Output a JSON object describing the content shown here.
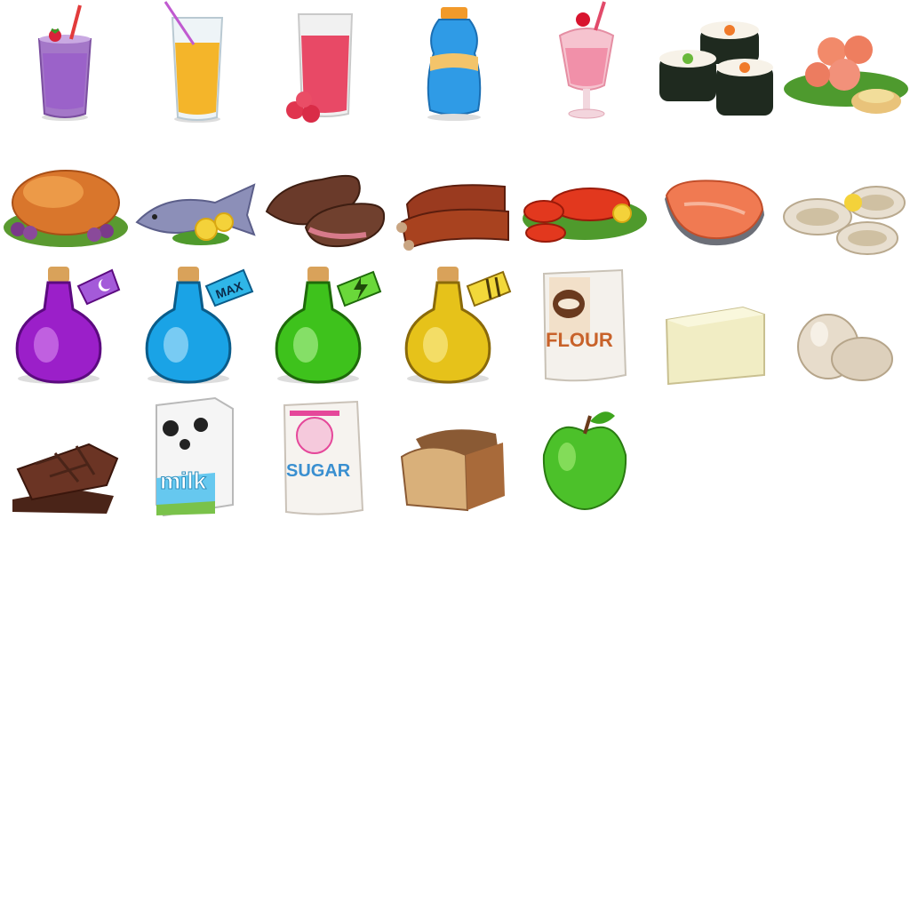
{
  "sheet": {
    "rows": [
      [
        "berry-smoothie",
        "orange-juice",
        "raspberry-juice",
        "sports-drink",
        "cherry-milkshake",
        "sushi-rolls",
        "shrimp-platter"
      ],
      [
        "roast-turkey",
        "grilled-fish",
        "steak",
        "bbq-ribs",
        "lobster",
        "salmon-steak",
        "oysters"
      ],
      [
        "purple-moon-potion",
        "blue-max-potion",
        "green-energy-potion",
        "yellow-food-potion",
        "flour-bag",
        "butter",
        "eggs"
      ],
      [
        "chocolate-bar",
        "milk-carton",
        "sugar-bag",
        "bread-loaf",
        "green-apple"
      ]
    ]
  },
  "labels": {
    "potion_max": "MAX",
    "flour": "FLOUR",
    "milk": "milk",
    "sugar": "SUGAR"
  },
  "colors": {
    "potion_purple": "#9b1fc9",
    "potion_blue": "#1aa3e6",
    "potion_green": "#3ec21c",
    "potion_yellow": "#e6c21a",
    "apple_green": "#4cc12a",
    "milk_blue": "#66c8ef",
    "sugar_pink": "#e5479a",
    "flour_brown": "#c8622a"
  }
}
